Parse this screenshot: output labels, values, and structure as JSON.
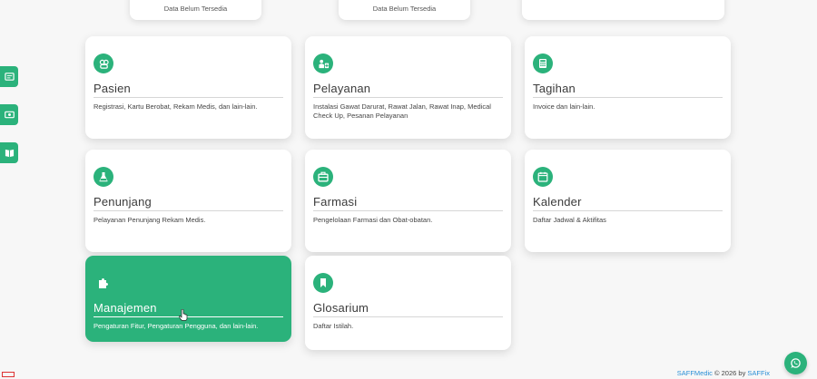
{
  "top_cards": [
    {
      "text": "Data Belum Tersedia"
    },
    {
      "text": "Data Belum Tersedia"
    },
    {
      "text": ""
    }
  ],
  "sidebar": {
    "buttons": [
      {
        "icon": "register-icon"
      },
      {
        "icon": "money-icon"
      },
      {
        "icon": "book-icon"
      }
    ]
  },
  "menu": [
    {
      "title": "Pasien",
      "desc": "Registrasi, Kartu Berobat, Rekam Medis, dan lain-lain.",
      "icon": "patients-icon"
    },
    {
      "title": "Pelayanan",
      "desc": "Instalasi Gawat Darurat, Rawat Jalan, Rawat Inap, Medical Check Up, Pesanan Pelayanan",
      "icon": "service-icon"
    },
    {
      "title": "Tagihan",
      "desc": "Invoice dan lain-lain.",
      "icon": "calculator-icon"
    },
    {
      "title": "Penunjang",
      "desc": "Pelayanan Penunjang Rekam Medis.",
      "icon": "flask-icon"
    },
    {
      "title": "Farmasi",
      "desc": "Pengelolaan Farmasi dan Obat-obatan.",
      "icon": "medkit-icon"
    },
    {
      "title": "Kalender",
      "desc": "Daftar Jadwal & Aktifitas",
      "icon": "calendar-icon"
    },
    {
      "title": "Manajemen",
      "desc": "Pengaturan Fitur, Pengaturan Pengguna, dan lain-lain.",
      "icon": "puzzle-icon"
    },
    {
      "title": "Glosarium",
      "desc": "Daftar Istilah.",
      "icon": "bookmark-icon"
    }
  ],
  "footer": {
    "brand": "SAFFMedic",
    "text": " © 2026 by ",
    "company": "SAFFix"
  },
  "colors": {
    "accent": "#2bb27b"
  }
}
